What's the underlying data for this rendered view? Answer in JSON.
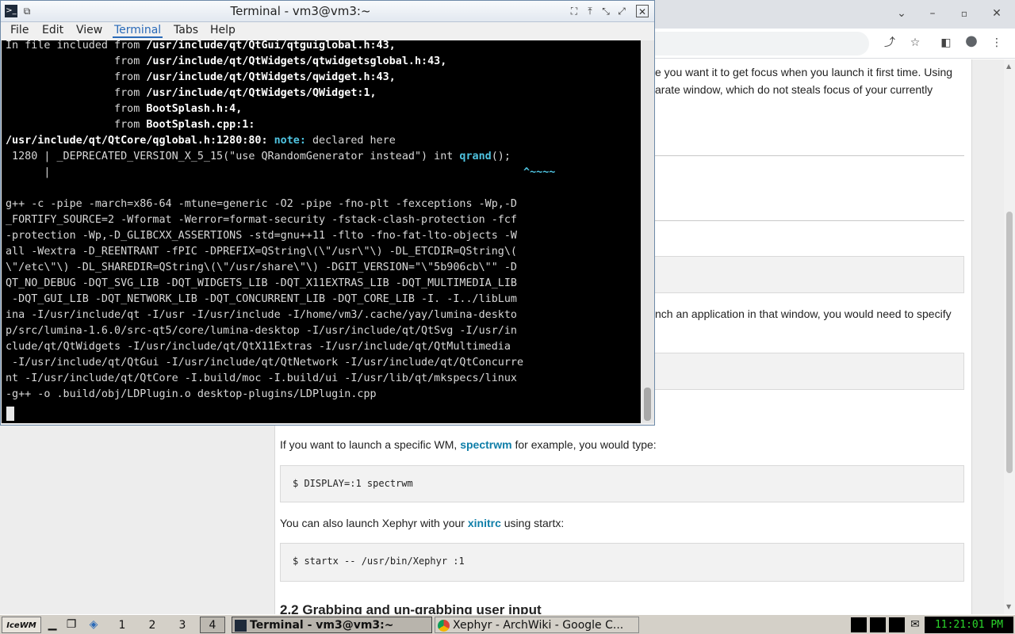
{
  "terminal": {
    "title": "Terminal - vm3@vm3:~",
    "menu": [
      "File",
      "Edit",
      "View",
      "Terminal",
      "Tabs",
      "Help"
    ],
    "lines": [
      {
        "plain": "In file included from ",
        "bold": "/usr/include/qt/QtGui/qtguiglobal.h:43,"
      },
      {
        "plain": "                 from ",
        "bold": "/usr/include/qt/QtWidgets/qtwidgetsglobal.h:43,"
      },
      {
        "plain": "                 from ",
        "bold": "/usr/include/qt/QtWidgets/qwidget.h:43,"
      },
      {
        "plain": "                 from ",
        "bold": "/usr/include/qt/QtWidgets/QWidget:1,"
      },
      {
        "plain": "                 from ",
        "bold": "BootSplash.h:4,"
      },
      {
        "plain": "                 from ",
        "bold": "BootSplash.cpp:1:"
      },
      {
        "bold": "/usr/include/qt/QtCore/qglobal.h:1280:80: ",
        "note": "note:",
        "plain": " declared here"
      },
      {
        "plain": " 1280 | _DEPRECATED_VERSION_X_5_15(\"use QRandomGenerator instead\") int ",
        "hl": "qrand",
        "tail": "();"
      },
      {
        "plain": "      |",
        "hl": "                                                                          ^~~~~"
      },
      {
        "plain": ""
      },
      {
        "plain": "g++ -c -pipe -march=x86-64 -mtune=generic -O2 -pipe -fno-plt -fexceptions -Wp,-D"
      },
      {
        "plain": "_FORTIFY_SOURCE=2 -Wformat -Werror=format-security -fstack-clash-protection -fcf"
      },
      {
        "plain": "-protection -Wp,-D_GLIBCXX_ASSERTIONS -std=gnu++11 -flto -fno-fat-lto-objects -W"
      },
      {
        "plain": "all -Wextra -D_REENTRANT -fPIC -DPREFIX=QString\\(\\\"/usr\\\"\\) -DL_ETCDIR=QString\\("
      },
      {
        "plain": "\\\"/etc\\\"\\) -DL_SHAREDIR=QString\\(\\\"/usr/share\\\"\\) -DGIT_VERSION=\"\\\"5b906cb\\\"\" -D"
      },
      {
        "plain": "QT_NO_DEBUG -DQT_SVG_LIB -DQT_WIDGETS_LIB -DQT_X11EXTRAS_LIB -DQT_MULTIMEDIA_LIB"
      },
      {
        "plain": " -DQT_GUI_LIB -DQT_NETWORK_LIB -DQT_CONCURRENT_LIB -DQT_CORE_LIB -I. -I../libLum"
      },
      {
        "plain": "ina -I/usr/include/qt -I/usr -I/usr/include -I/home/vm3/.cache/yay/lumina-deskto"
      },
      {
        "plain": "p/src/lumina-1.6.0/src-qt5/core/lumina-desktop -I/usr/include/qt/QtSvg -I/usr/in"
      },
      {
        "plain": "clude/qt/QtWidgets -I/usr/include/qt/QtX11Extras -I/usr/include/qt/QtMultimedia"
      },
      {
        "plain": " -I/usr/include/qt/QtGui -I/usr/include/qt/QtNetwork -I/usr/include/qt/QtConcurre"
      },
      {
        "plain": "nt -I/usr/include/qt/QtCore -I.build/moc -I.build/ui -I/usr/lib/qt/mkspecs/linux"
      },
      {
        "plain": "-g++ -o .build/obj/LDPlugin.o desktop-plugins/LDPlugin.cpp"
      }
    ]
  },
  "browser": {
    "text1a": "e you want it to get focus when you launch it first time. Using",
    "text1b": "arate window, which do not steals focus of your currently",
    "text2": "nch an application in that window, you would need to specify",
    "wm_before": "If you want to launch a specific WM, ",
    "wm_link": "spectrwm",
    "wm_after": " for example, you would type:",
    "code1": "$ DISPLAY=:1 spectrwm",
    "xinit_before": "You can also launch Xephyr with your ",
    "xinit_link": "xinitrc",
    "xinit_after": " using startx:",
    "code2": "$ startx -- /usr/bin/Xephyr :1",
    "heading": "2.2  Grabbing and un-grabbing user input"
  },
  "taskbar": {
    "logo": "IceWM",
    "desktops": [
      "1",
      "2",
      "3",
      "4"
    ],
    "current_desktop": "4",
    "tasks": [
      {
        "label": "Terminal - vm3@vm3:~",
        "active": true
      },
      {
        "label": "Xephyr - ArchWiki - Google C...",
        "active": false
      }
    ],
    "clock": "11:21:01 PM"
  },
  "colors": {
    "terminal_bg": "#000000",
    "note": "#4fc3e0",
    "link": "#0f7ea8",
    "clock": "#2bd62b"
  }
}
